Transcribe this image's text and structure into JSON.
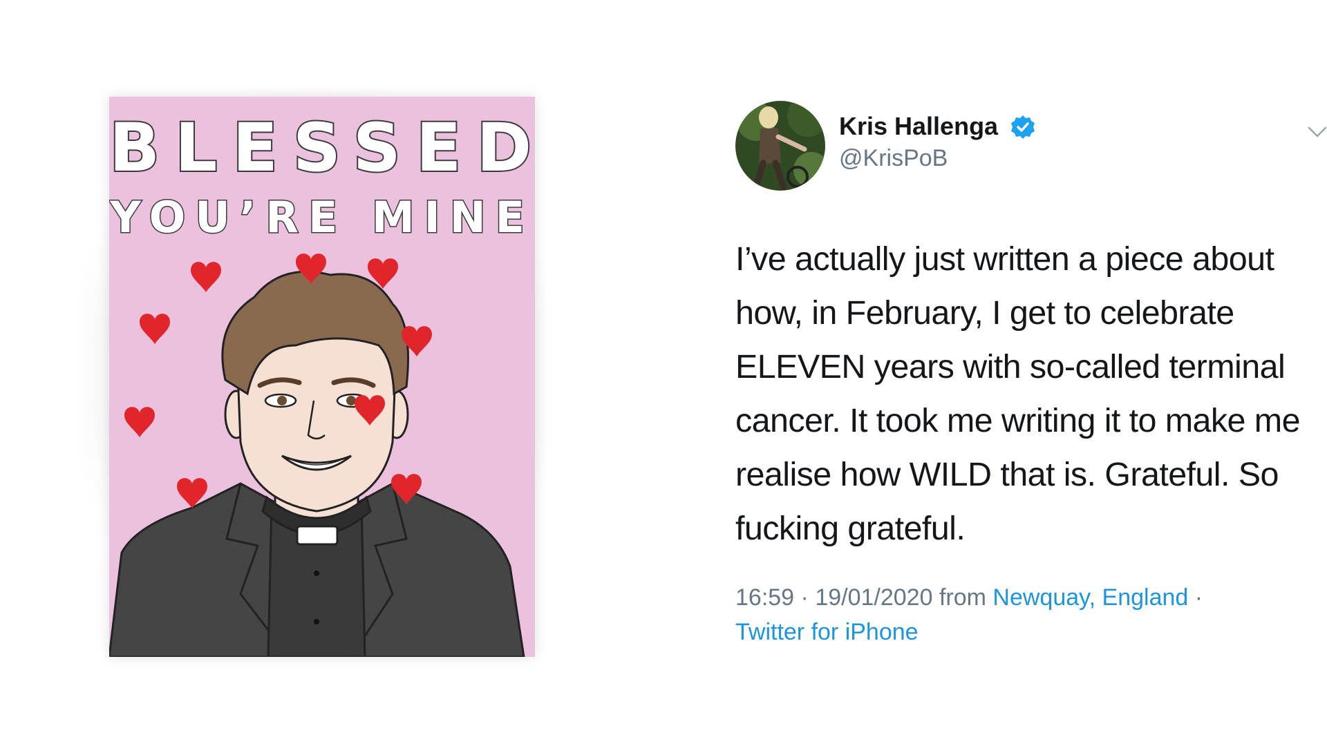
{
  "card": {
    "title": "BLESSED",
    "subtitle": "YOU’RE MINE",
    "colors": {
      "background": "#ecc1de",
      "heart": "#e0262b",
      "jacket": "#454545"
    }
  },
  "tweet": {
    "display_name": "Kris Hallenga",
    "handle": "@KrisPoB",
    "verified": true,
    "text": "I’ve actually just written a piece about how, in February, I get to celebrate ELEVEN years with so-called terminal cancer. It took me writing it to make me realise how WILD that is. Grateful. So fucking grateful.",
    "time": "16:59",
    "date": "19/01/2020",
    "from_label": "from",
    "location": "Newquay, England",
    "source": "Twitter for iPhone",
    "separator": "·",
    "icons": {
      "verified": "verified-badge-icon",
      "menu": "chevron-down-icon"
    },
    "colors": {
      "text": "#14171a",
      "secondary": "#657786",
      "link": "#1b95e0",
      "verified": "#1da1f2"
    }
  }
}
